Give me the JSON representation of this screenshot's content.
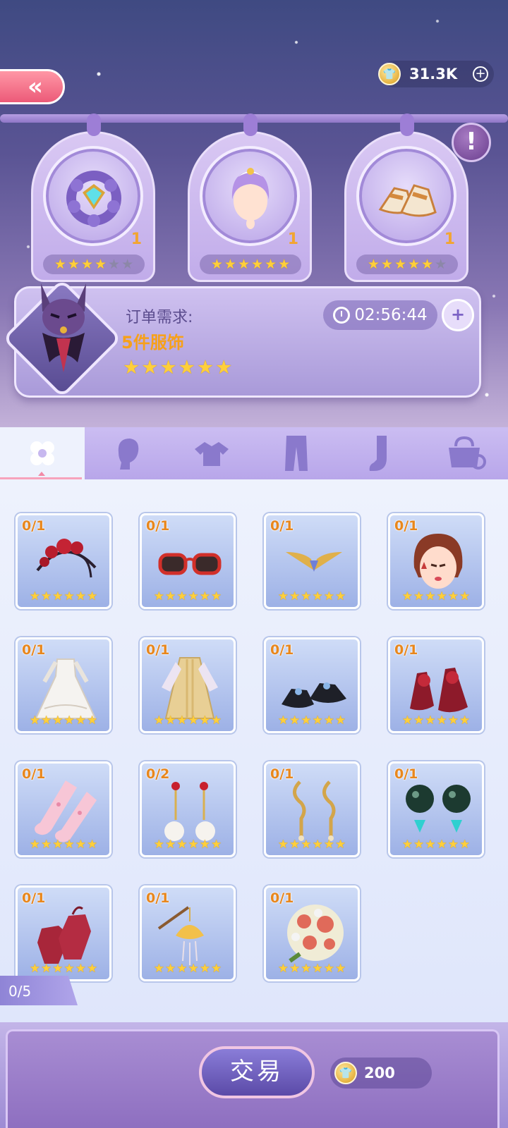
{
  "header": {
    "back_label": "«",
    "coins": "31.3K",
    "add_label": "+",
    "info_label": "!"
  },
  "requested_items": [
    {
      "name": "bracelet",
      "count": "1",
      "stars": 4,
      "max_stars": 6
    },
    {
      "name": "hairstyle",
      "count": "1",
      "stars": 6,
      "max_stars": 6
    },
    {
      "name": "shoes",
      "count": "1",
      "stars": 5,
      "max_stars": 6
    }
  ],
  "order": {
    "label": "订单需求:",
    "need": "5件服饰",
    "stars": 6,
    "timer": "02:56:44",
    "speedup_label": "+"
  },
  "tabs": [
    {
      "name": "all",
      "icon": "clover-icon",
      "active": true
    },
    {
      "name": "hair",
      "icon": "head-icon",
      "active": false
    },
    {
      "name": "top",
      "icon": "shirt-icon",
      "active": false
    },
    {
      "name": "bottom",
      "icon": "pants-icon",
      "active": false
    },
    {
      "name": "socks",
      "icon": "sock-icon",
      "active": false
    },
    {
      "name": "accessory",
      "icon": "bag-icon",
      "active": false
    }
  ],
  "items": [
    {
      "qty": "0/1",
      "kind": "rose-headband",
      "stars": 6
    },
    {
      "qty": "0/1",
      "kind": "red-sunglasses",
      "stars": 6
    },
    {
      "qty": "0/1",
      "kind": "golden-wing-mask",
      "stars": 6
    },
    {
      "qty": "0/1",
      "kind": "face-makeup",
      "stars": 6
    },
    {
      "qty": "0/1",
      "kind": "white-gown",
      "stars": 6
    },
    {
      "qty": "0/1",
      "kind": "golden-robe",
      "stars": 6
    },
    {
      "qty": "0/1",
      "kind": "black-shoes",
      "stars": 6
    },
    {
      "qty": "0/1",
      "kind": "red-heels",
      "stars": 6
    },
    {
      "qty": "0/1",
      "kind": "pink-stockings",
      "stars": 6
    },
    {
      "qty": "0/2",
      "kind": "pearl-earrings",
      "stars": 6
    },
    {
      "qty": "0/1",
      "kind": "gold-earrings",
      "stars": 6
    },
    {
      "qty": "0/1",
      "kind": "black-pearl-earrings",
      "stars": 6
    },
    {
      "qty": "0/1",
      "kind": "red-gloves",
      "stars": 6
    },
    {
      "qty": "0/1",
      "kind": "lotus-hairpin",
      "stars": 6
    },
    {
      "qty": "0/1",
      "kind": "bouquet",
      "stars": 6
    }
  ],
  "progress": "0/5",
  "trade": {
    "label": "交易",
    "price": "200"
  },
  "colors": {
    "star_on": "#ffcf3a",
    "star_off": "#8c87a8",
    "qty_text": "#e8871d",
    "order_need": "#f7a019"
  }
}
